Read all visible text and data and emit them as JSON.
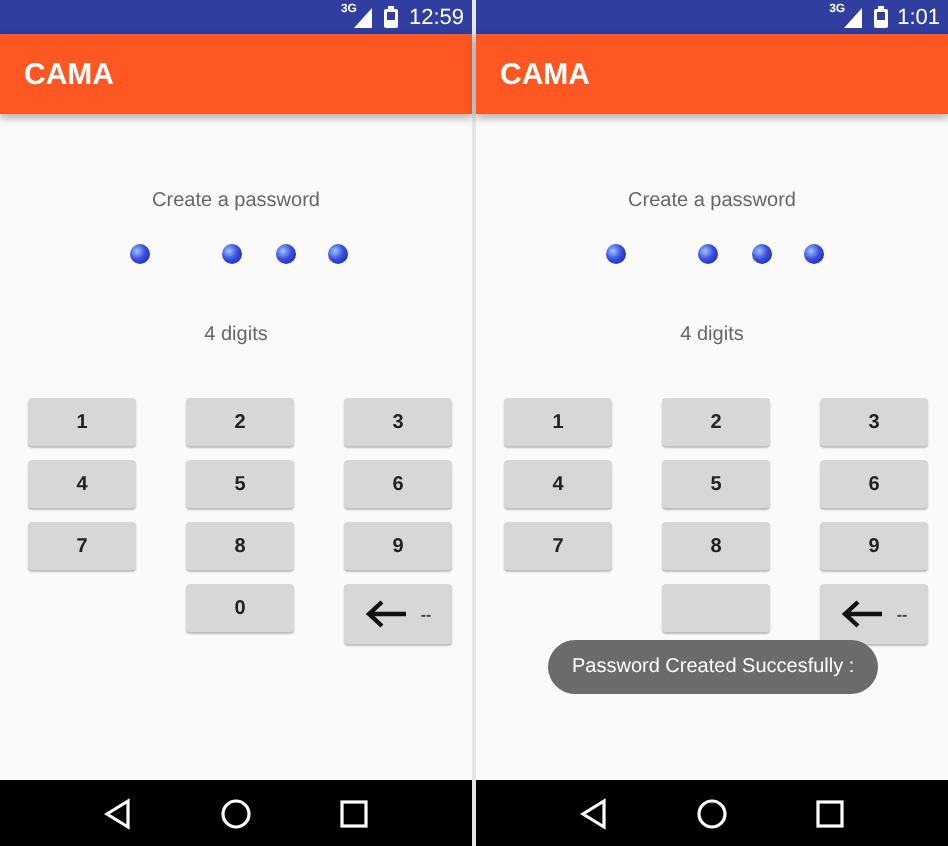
{
  "screens": [
    {
      "status_bar": {
        "network": "3G",
        "time": "12:59"
      },
      "app_bar": {
        "title": "CAMA"
      },
      "prompt": "Create a password",
      "hint": "4 digits",
      "keys": [
        {
          "kind": "digit",
          "label": "1"
        },
        {
          "kind": "digit",
          "label": "2"
        },
        {
          "kind": "digit",
          "label": "3"
        },
        {
          "kind": "digit",
          "label": "4"
        },
        {
          "kind": "digit",
          "label": "5"
        },
        {
          "kind": "digit",
          "label": "6"
        },
        {
          "kind": "digit",
          "label": "7"
        },
        {
          "kind": "digit",
          "label": "8"
        },
        {
          "kind": "digit",
          "label": "9"
        },
        {
          "kind": "digit",
          "label": "0"
        },
        {
          "kind": "backspace",
          "label": "--"
        }
      ]
    },
    {
      "status_bar": {
        "network": "3G",
        "time": "1:01"
      },
      "app_bar": {
        "title": "CAMA"
      },
      "prompt": "Create a password",
      "hint": "4 digits",
      "keys": [
        {
          "kind": "digit",
          "label": "1"
        },
        {
          "kind": "digit",
          "label": "2"
        },
        {
          "kind": "digit",
          "label": "3"
        },
        {
          "kind": "digit",
          "label": "4"
        },
        {
          "kind": "digit",
          "label": "5"
        },
        {
          "kind": "digit",
          "label": "6"
        },
        {
          "kind": "digit",
          "label": "7"
        },
        {
          "kind": "digit",
          "label": "8"
        },
        {
          "kind": "digit",
          "label": "9"
        },
        {
          "kind": "digit"
        },
        {
          "kind": "backspace",
          "label": "--"
        }
      ],
      "toast": "Password Created Succesfully :"
    }
  ]
}
